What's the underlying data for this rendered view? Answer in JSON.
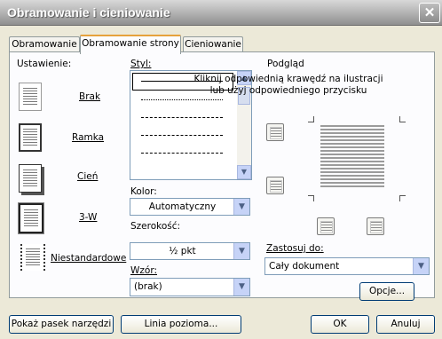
{
  "window": {
    "title": "Obramowanie i cieniowanie",
    "close_glyph": "✕"
  },
  "tabs": [
    {
      "label": "Obramowanie"
    },
    {
      "label": "Obramowanie strony"
    },
    {
      "label": "Cieniowanie"
    }
  ],
  "settings": {
    "heading": "Ustawienie:",
    "items": [
      {
        "label": "Brak"
      },
      {
        "label": "Ramka"
      },
      {
        "label": "Cień"
      },
      {
        "label": "3-W"
      },
      {
        "label": "Niestandardowe"
      }
    ]
  },
  "style": {
    "label": "Styl:",
    "color_label": "Kolor:",
    "color_value": "Automatyczny",
    "width_label": "Szerokość:",
    "width_value": "½ pkt",
    "art_label": "Wzór:",
    "art_value": "(brak)"
  },
  "preview": {
    "heading": "Podgląd",
    "instructions_line1": "Kliknij odpowiednią krawędź na ilustracji",
    "instructions_line2": "lub użyj odpowiedniego przycisku",
    "apply_label": "Zastosuj do:",
    "apply_value": "Cały dokument",
    "options_button": "Opcje..."
  },
  "footer": {
    "toolbar_button": "Pokaż pasek narzędzi",
    "horizontal_line_button": "Linia pozioma...",
    "ok_button": "OK",
    "cancel_button": "Anuluj"
  }
}
